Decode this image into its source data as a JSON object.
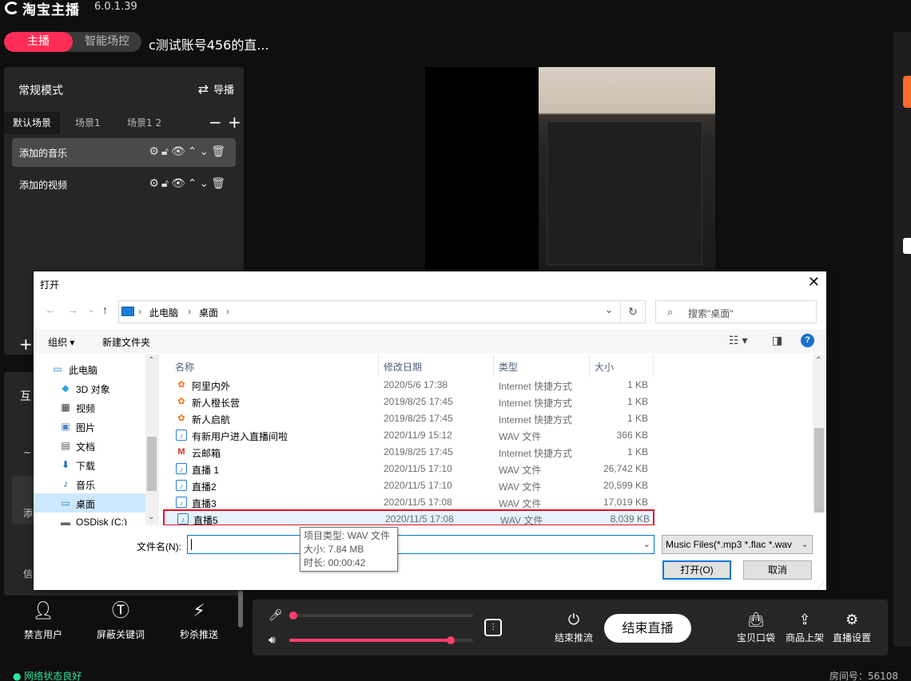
{
  "app": {
    "logo_text": "淘宝主播",
    "version": "6.0.1.39",
    "mode_tabs": [
      "主播",
      "智能场控"
    ],
    "room_title": "c测试账号456的直..."
  },
  "scene_panel": {
    "title": "常规模式",
    "guide_label": "导播",
    "tabs": [
      "默认场景",
      "场景1",
      "场景1 2"
    ],
    "sources": [
      {
        "name": "添加的音乐",
        "selected": true
      },
      {
        "name": "添加的视频",
        "selected": false
      }
    ]
  },
  "interaction_panel": {
    "title": "互",
    "item1_label": "~",
    "item2_label": "添",
    "item3_label": "信"
  },
  "tools": [
    {
      "label": "禁言用户",
      "icon": "mute-user-icon"
    },
    {
      "label": "屏蔽关键词",
      "icon": "block-keyword-icon"
    },
    {
      "label": "秒杀推送",
      "icon": "flash-sale-icon"
    }
  ],
  "status": {
    "network": "● 网络状态良好",
    "room_no": "房间号：56108"
  },
  "controls": {
    "mic_level": 0.02,
    "speaker_level": 0.88,
    "end_stream_label": "结束推流",
    "end_live_label": "结束直播",
    "right_buttons": [
      "宝贝口袋",
      "商品上架",
      "直播设置"
    ]
  },
  "colors": {
    "accent": "#ff2d55",
    "network_ok": "#2ee7a1",
    "highlight_box": "#e81123"
  },
  "dialog": {
    "title": "打开",
    "breadcrumb": [
      "此电脑",
      "桌面"
    ],
    "search_placeholder": "搜索\"桌面\"",
    "organize": "组织 ▾",
    "new_folder": "新建文件夹",
    "tree": [
      {
        "label": "此电脑",
        "icon": "pc-icon"
      },
      {
        "label": "3D 对象",
        "icon": "3d-objects-icon"
      },
      {
        "label": "视频",
        "icon": "videos-icon"
      },
      {
        "label": "图片",
        "icon": "pictures-icon"
      },
      {
        "label": "文档",
        "icon": "documents-icon"
      },
      {
        "label": "下载",
        "icon": "downloads-icon"
      },
      {
        "label": "音乐",
        "icon": "music-icon"
      },
      {
        "label": "桌面",
        "icon": "desktop-icon",
        "selected": true
      },
      {
        "label": "OSDisk (C:)",
        "icon": "disk-icon"
      }
    ],
    "columns": [
      "名称",
      "修改日期",
      "类型",
      "大小"
    ],
    "files": [
      {
        "name": "阿里内外",
        "date": "2020/5/6 17:38",
        "type": "Internet 快捷方式",
        "size": "1 KB",
        "icon": "orange"
      },
      {
        "name": "新人橙长营",
        "date": "2019/8/25 17:45",
        "type": "Internet 快捷方式",
        "size": "1 KB",
        "icon": "orange"
      },
      {
        "name": "新人启航",
        "date": "2019/8/25 17:45",
        "type": "Internet 快捷方式",
        "size": "1 KB",
        "icon": "orange"
      },
      {
        "name": "有新用户进入直播间啦",
        "date": "2020/11/9 15:12",
        "type": "WAV 文件",
        "size": "366 KB",
        "icon": "wav"
      },
      {
        "name": "云邮箱",
        "date": "2019/8/25 17:45",
        "type": "Internet 快捷方式",
        "size": "1 KB",
        "icon": "mail"
      },
      {
        "name": "直播 1",
        "date": "2020/11/5 17:10",
        "type": "WAV 文件",
        "size": "26,742 KB",
        "icon": "wav"
      },
      {
        "name": "直播2",
        "date": "2020/11/5 17:10",
        "type": "WAV 文件",
        "size": "20,599 KB",
        "icon": "wav"
      },
      {
        "name": "直播3",
        "date": "2020/11/5 17:08",
        "type": "WAV 文件",
        "size": "17,019 KB",
        "icon": "wav"
      },
      {
        "name": "直播5",
        "date": "2020/11/5 17:08",
        "type": "WAV 文件",
        "size": "8,039 KB",
        "icon": "wav",
        "highlighted": true
      }
    ],
    "filename_label": "文件名(N):",
    "filename_value": "",
    "filter_value": "Music Files(*.mp3 *.flac *.wav",
    "open_button": "打开(O)",
    "cancel_button": "取消",
    "tooltip": [
      "项目类型: WAV 文件",
      "大小: 7.84 MB",
      "时长: 00:00:42"
    ]
  }
}
